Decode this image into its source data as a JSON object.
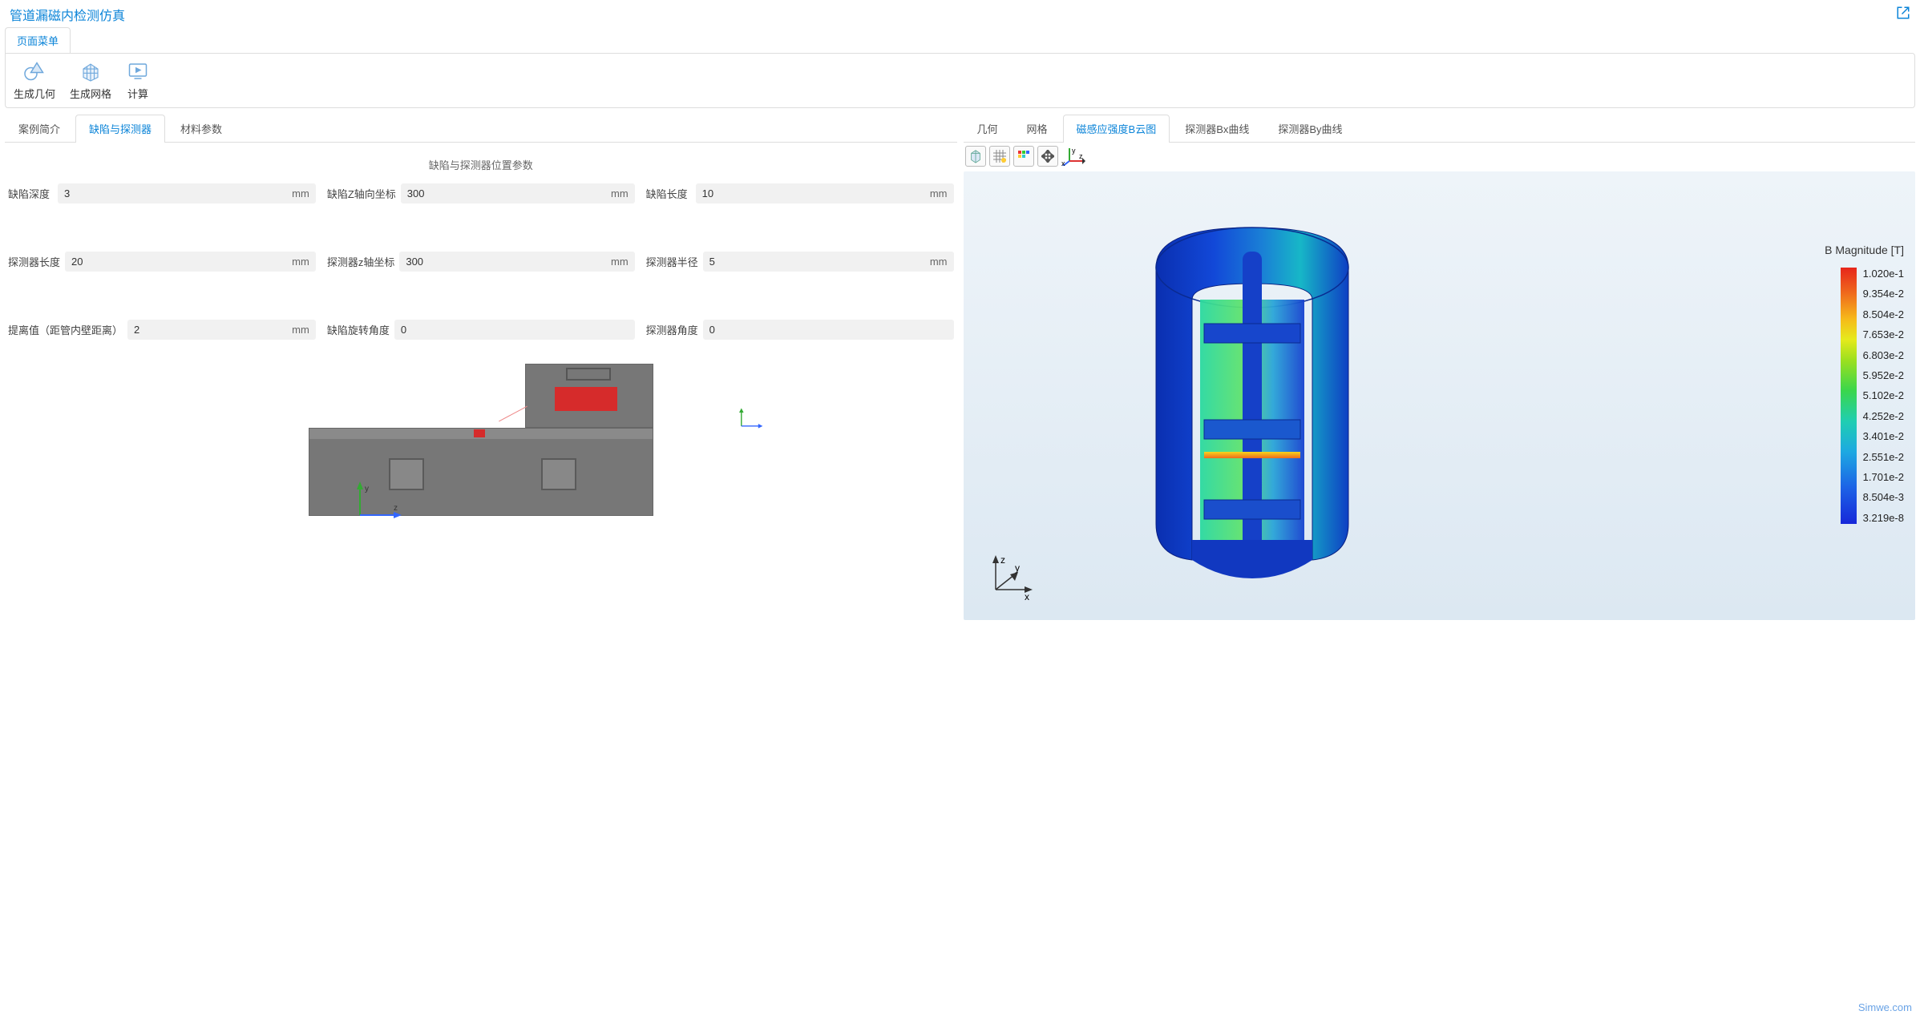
{
  "header": {
    "title": "管道漏磁内检测仿真"
  },
  "menu": {
    "tab": "页面菜单"
  },
  "toolbar": {
    "gen_geom": "生成几何",
    "gen_mesh": "生成网格",
    "compute": "计算"
  },
  "left_tabs": {
    "case_intro": "案例简介",
    "defect_detector": "缺陷与探测器",
    "material_params": "材料参数"
  },
  "section": {
    "title": "缺陷与探测器位置参数"
  },
  "fields": {
    "defect_depth": {
      "label": "缺陷深度",
      "value": "3",
      "unit": "mm"
    },
    "defect_z": {
      "label": "缺陷Z轴向坐标",
      "value": "300",
      "unit": "mm"
    },
    "defect_length": {
      "label": "缺陷长度",
      "value": "10",
      "unit": "mm"
    },
    "det_length": {
      "label": "探测器长度",
      "value": "20",
      "unit": "mm"
    },
    "det_z": {
      "label": "探测器z轴坐标",
      "value": "300",
      "unit": "mm"
    },
    "det_radius": {
      "label": "探测器半径",
      "value": "5",
      "unit": "mm"
    },
    "liftoff": {
      "label": "提离值（距管内壁距离）",
      "value": "2",
      "unit": "mm"
    },
    "defect_angle": {
      "label": "缺陷旋转角度",
      "value": "0"
    },
    "det_angle": {
      "label": "探测器角度",
      "value": "0"
    }
  },
  "right_tabs": {
    "geom": "几何",
    "mesh": "网格",
    "b_cloud": "磁感应强度B云图",
    "det_bx": "探测器Bx曲线",
    "det_by": "探测器By曲线"
  },
  "legend": {
    "title": "B Magnitude [T]",
    "ticks": [
      "1.020e-1",
      "9.354e-2",
      "8.504e-2",
      "7.653e-2",
      "6.803e-2",
      "5.952e-2",
      "5.102e-2",
      "4.252e-2",
      "3.401e-2",
      "2.551e-2",
      "1.701e-2",
      "8.504e-3",
      "3.219e-8"
    ]
  },
  "axes": {
    "x": "x",
    "y": "y",
    "z": "z"
  },
  "footer": {
    "brand": "Simwe.com"
  }
}
